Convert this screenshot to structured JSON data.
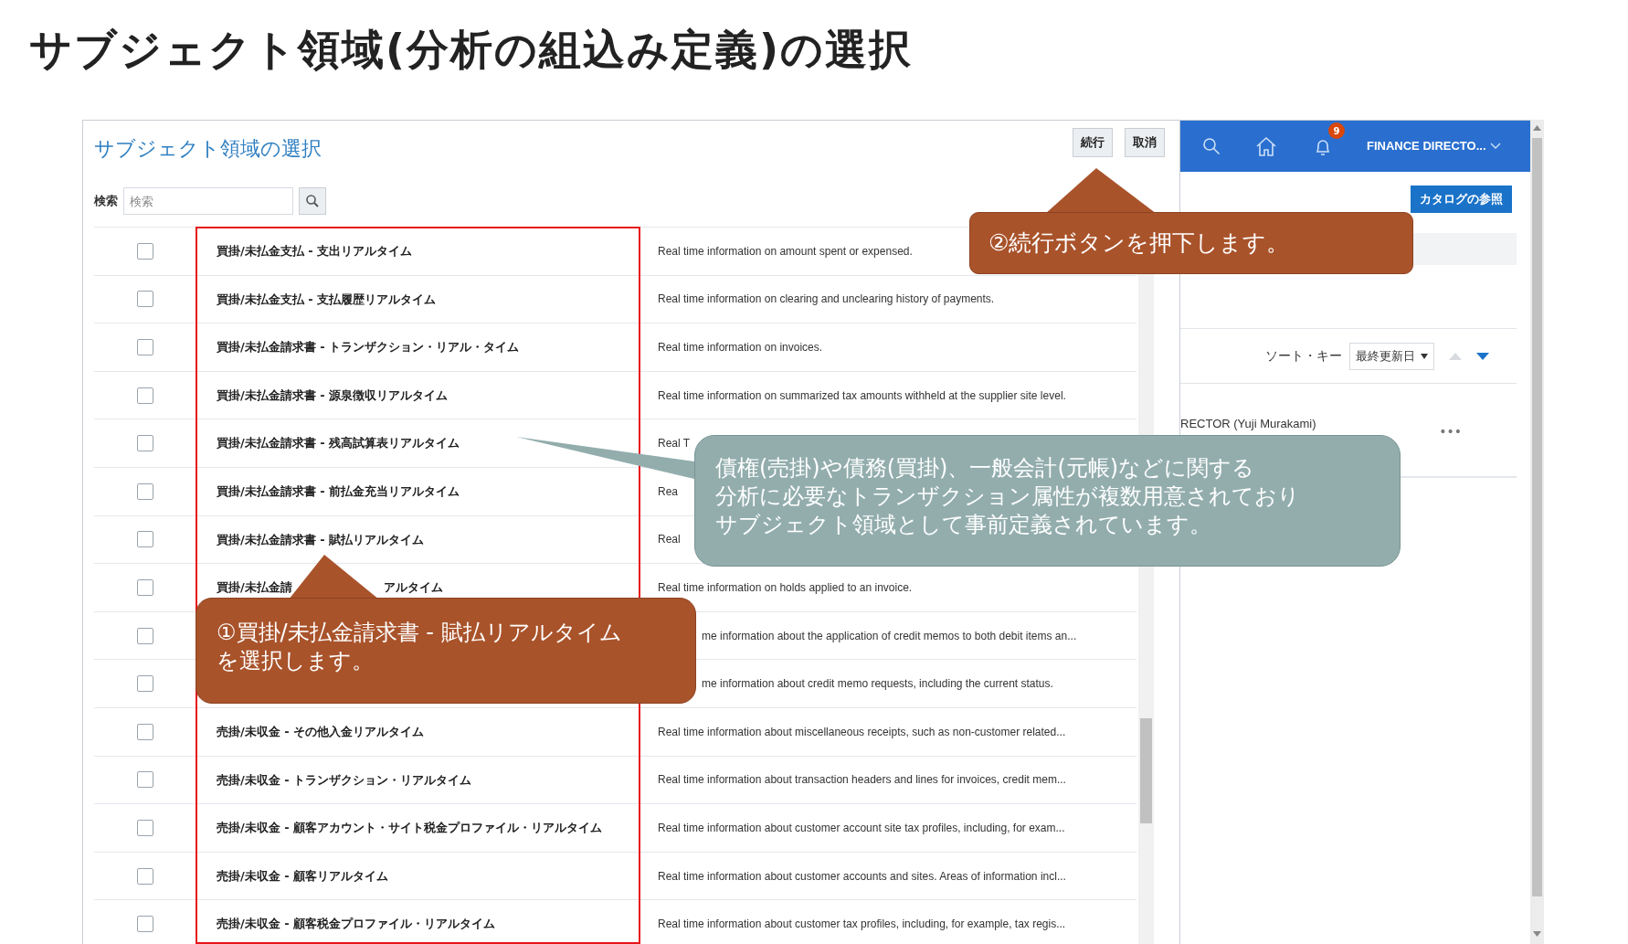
{
  "title": "サブジェクト領域(分析の組込み定義)の選択",
  "dialog": {
    "title": "サブジェクト領域の選択",
    "buttons": [
      "続行",
      "取消"
    ],
    "search": {
      "label": "検索",
      "placeholder": "検索"
    },
    "rows": [
      {
        "checked": false,
        "name": "買掛/未払金支払 - 支出リアルタイム",
        "description": "Real time information on amount spent or expensed."
      },
      {
        "checked": false,
        "name": "買掛/未払金支払 - 支払履歴リアルタイム",
        "description": "Real time information on clearing and unclearing history of payments."
      },
      {
        "checked": false,
        "name": "買掛/未払金請求書 - トランザクション・リアル・タイム",
        "description": "Real time information on invoices."
      },
      {
        "checked": false,
        "name": "買掛/未払金請求書 - 源泉徴収リアルタイム",
        "description": "Real time information on summarized tax amounts withheld at the supplier site level."
      },
      {
        "checked": false,
        "name": "買掛/未払金請求書 - 残高試算表リアルタイム",
        "description": "Real T"
      },
      {
        "checked": false,
        "name": "買掛/未払金請求書 - 前払金充当リアルタイム",
        "description": "Rea"
      },
      {
        "checked": false,
        "name": "買掛/未払金請求書 - 賦払リアルタイム",
        "description": "Real"
      },
      {
        "checked": false,
        "name": "買掛/未払金請",
        "name_end": "アルタイム",
        "description": "Real time information on holds applied to an invoice."
      },
      {
        "checked": false,
        "cut_left": true,
        "description": "me information about the application of credit memos to both debit items an..."
      },
      {
        "checked": false,
        "cut_left": true,
        "description": "me information about credit memo requests, including the current status."
      },
      {
        "checked": false,
        "name": "売掛/未収金 - その他入金リアルタイム",
        "description": "Real time information about miscellaneous receipts, such as non-customer related..."
      },
      {
        "checked": false,
        "name": "売掛/未収金 - トランザクション・リアルタイム",
        "description": "Real time information about transaction headers and lines for invoices, credit mem..."
      },
      {
        "checked": false,
        "name": "売掛/未収金 - 顧客アカウント・サイト税金プロファイル・リアルタイム",
        "description": "Real time information about customer account site tax profiles, including, for exam..."
      },
      {
        "checked": false,
        "name": "売掛/未収金 - 顧客リアルタイム",
        "description": "Real time information about customer accounts and sites. Areas of information incl..."
      },
      {
        "checked": false,
        "name": "売掛/未収金 - 顧客税金プロファイル・リアルタイム",
        "description": "Real time information about customer tax profiles, including, for example, tax regis..."
      }
    ]
  },
  "header": {
    "notification_count": "9",
    "user": "FINANCE DIRECTO..."
  },
  "catalog_button": "カタログの参照",
  "sort": {
    "label": "ソート・キー",
    "value": "最終更新日"
  },
  "list_item": {
    "text": "RECTOR (Yuji Murakami)",
    "menu": "•••"
  },
  "callouts": {
    "continue_step": {
      "lines": [
        "②続行ボタンを押下します。"
      ]
    },
    "note": {
      "lines": [
        "債権(売掛)や債務(買掛)、一般会計(元帳)などに関する",
        "分析に必要なトランザクション属性が複数用意されており",
        "サブジェクト領域として事前定義されています。"
      ]
    },
    "select_step": {
      "lines": [
        "①買掛/未払金請求書 - 賦払リアルタイム",
        "を選択します。"
      ]
    }
  }
}
